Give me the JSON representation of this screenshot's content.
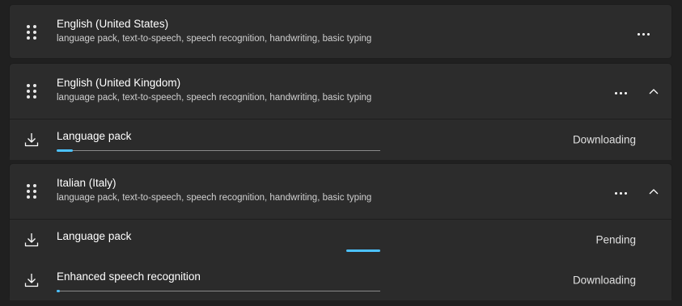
{
  "languages": [
    {
      "name": "English (United States)",
      "features": "language pack, text-to-speech, speech recognition, handwriting, basic typing",
      "expanded": false,
      "items": []
    },
    {
      "name": "English (United Kingdom)",
      "features": "language pack, text-to-speech, speech recognition, handwriting, basic typing",
      "expanded": true,
      "items": [
        {
          "label": "Language pack",
          "status": "Downloading",
          "progress": 0.05,
          "indeterminate": false
        }
      ]
    },
    {
      "name": "Italian (Italy)",
      "features": "language pack, text-to-speech, speech recognition, handwriting, basic typing",
      "expanded": true,
      "items": [
        {
          "label": "Language pack",
          "status": "Pending",
          "progress": null,
          "indeterminate": true
        },
        {
          "label": "Enhanced speech recognition",
          "status": "Downloading",
          "progress": 0.01,
          "indeterminate": false
        }
      ]
    }
  ],
  "icons": {
    "drag": "drag-handle-icon",
    "more": "more-options-icon",
    "collapse": "chevron-up-icon",
    "download": "download-icon"
  },
  "colors": {
    "accent": "#4cc2ff",
    "card": "#2c2c2c",
    "background": "#202020"
  }
}
